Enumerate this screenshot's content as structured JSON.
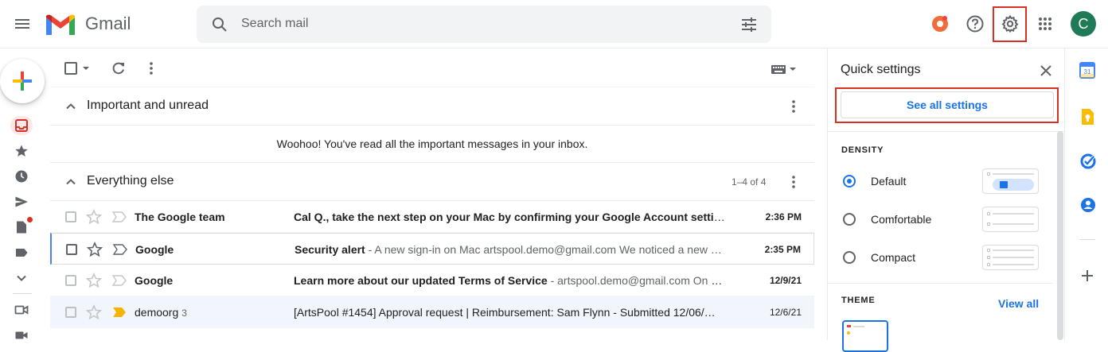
{
  "app": {
    "name": "Gmail"
  },
  "header": {
    "search_placeholder": "Search mail",
    "avatar_letter": "C"
  },
  "sections": [
    {
      "title": "Important and unread",
      "empty_message": "Woohoo! You've read all the important messages in your inbox."
    },
    {
      "title": "Everything else",
      "count": "1–4 of 4"
    }
  ],
  "emails": [
    {
      "sender": "The Google team",
      "thread_count": "",
      "subject": "Cal Q., take the next step on your Mac by confirming your Google Account settings",
      "snippet": " -",
      "date": "2:36 PM",
      "unread": true,
      "important_marker": false
    },
    {
      "sender": "Google",
      "thread_count": "",
      "subject": "Security alert",
      "snippet": " - A new sign-in on Mac artspool.demo@gmail.com We noticed a new …",
      "date": "2:35 PM",
      "unread": true,
      "important_marker": false
    },
    {
      "sender": "Google",
      "thread_count": "",
      "subject": "Learn more about our updated Terms of Service",
      "snippet": " - artspool.demo@gmail.com On J…",
      "date": "12/9/21",
      "unread": true,
      "important_marker": false
    },
    {
      "sender": "demoorg",
      "thread_count": "3",
      "subject": "[ArtsPool #1454] Approval request | Reimbursement: Sam Flynn - Submitted 12/06/…",
      "snippet": "",
      "date": "12/6/21",
      "unread": false,
      "important_marker": true
    }
  ],
  "quick_settings": {
    "title": "Quick settings",
    "see_all": "See all settings",
    "density_heading": "DENSITY",
    "density_options": [
      "Default",
      "Comfortable",
      "Compact"
    ],
    "density_selected": "Default",
    "theme_heading": "THEME",
    "view_all": "View all"
  },
  "colors": {
    "accent": "#1a73e8",
    "highlight": "#d93025",
    "avatar": "#1e7b55",
    "important": "#f4b400"
  }
}
